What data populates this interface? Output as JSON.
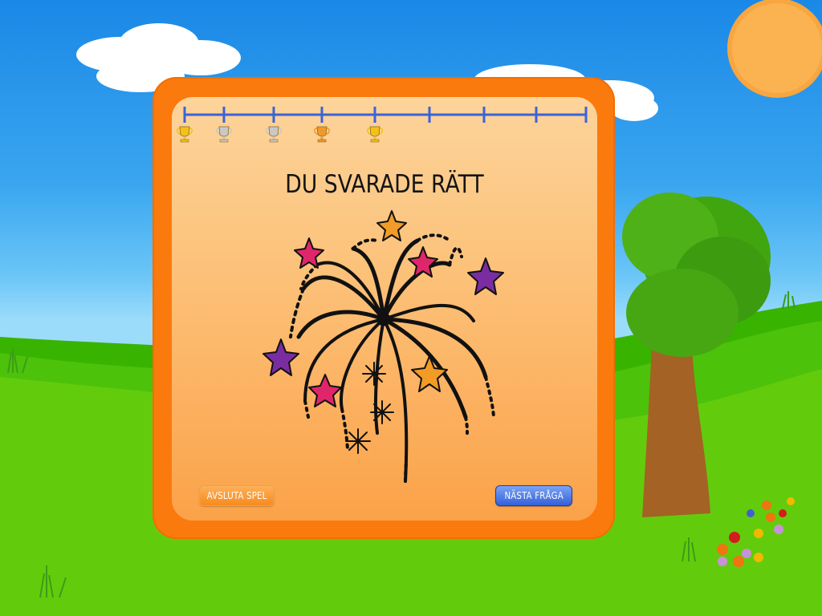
{
  "game": {
    "result_title": "DU SVARADE RÄTT",
    "quit_label": "AVSLUTA SPEL",
    "next_label": "NÄSTA FRÅGA"
  },
  "progress": {
    "total_marks": 9,
    "trophies": [
      {
        "step": 1,
        "color": "gold"
      },
      {
        "step": 2,
        "color": "silver"
      },
      {
        "step": 3,
        "color": "silver"
      },
      {
        "step": 4,
        "color": "bronze"
      },
      {
        "step": 5,
        "color": "gold"
      }
    ]
  },
  "colors": {
    "frame": "#fb7a0d",
    "track": "#3a63d8",
    "gold": "#f2c21a",
    "silver": "#c8c8c8",
    "bronze": "#f19a2a",
    "next_button": "#2f5fd8",
    "quit_button": "#f7891b"
  },
  "icons": [
    "trophy-icon",
    "fireworks-illustration",
    "sun-icon",
    "tree-icon",
    "flowers-icon",
    "cloud-icon"
  ]
}
